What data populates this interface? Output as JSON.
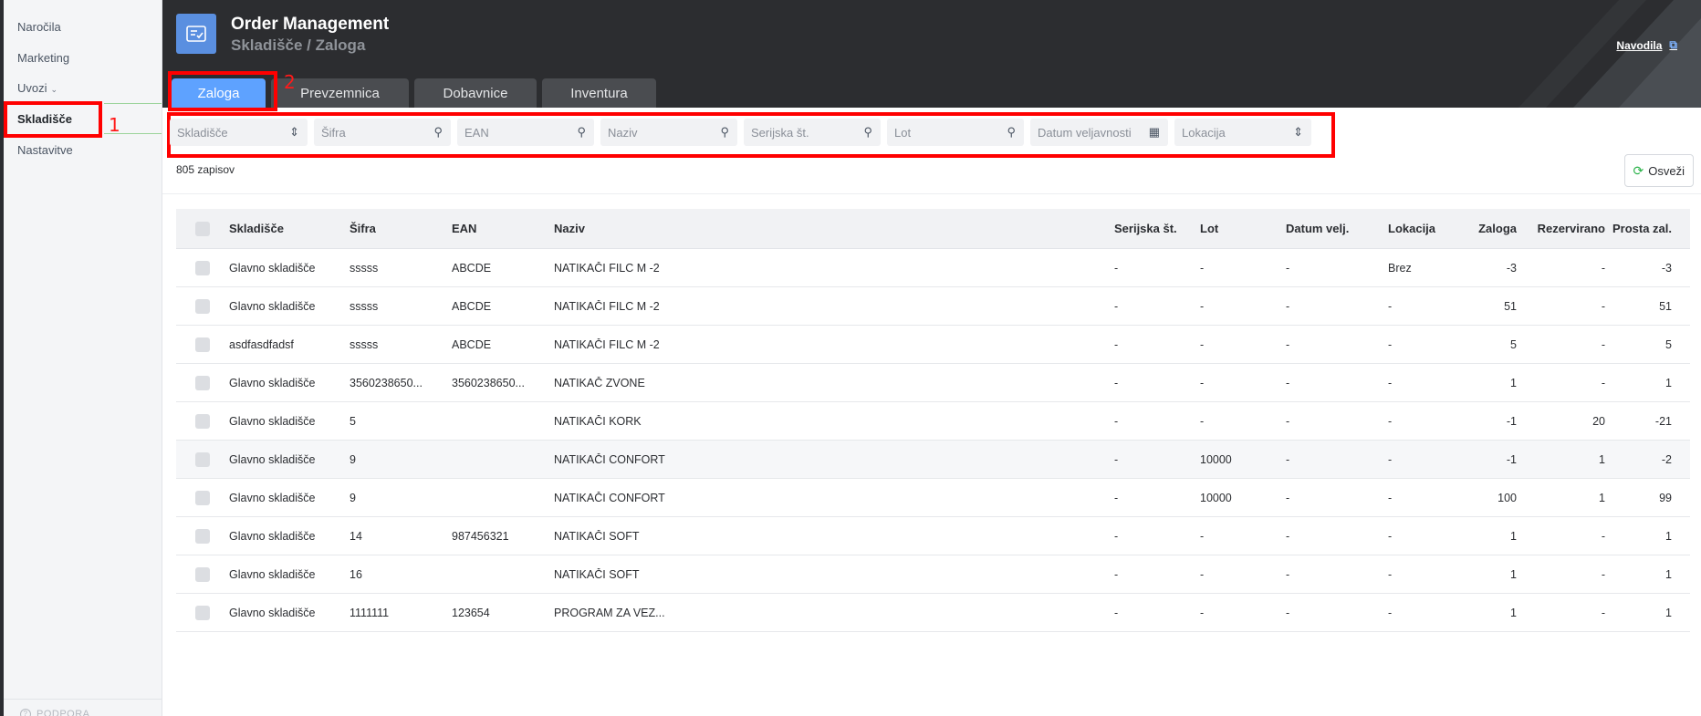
{
  "sidebar": {
    "items": [
      {
        "label": "Naročila"
      },
      {
        "label": "Marketing"
      },
      {
        "label": "Uvozi"
      },
      {
        "label": "Skladišče"
      },
      {
        "label": "Nastavitve"
      }
    ],
    "support_label": "PODPORA"
  },
  "header": {
    "title": "Order Management",
    "subtitle": "Skladišče / Zaloga",
    "help_link": "Navodila"
  },
  "tabs": [
    {
      "label": "Zaloga",
      "active": true
    },
    {
      "label": "Prevzemnica"
    },
    {
      "label": "Dobavnice"
    },
    {
      "label": "Inventura"
    }
  ],
  "annotations": {
    "one": "1",
    "two": "2"
  },
  "filters": {
    "skladisce": "Skladišče",
    "sifra": "Šifra",
    "ean": "EAN",
    "naziv": "Naziv",
    "serijska": "Serijska št.",
    "lot": "Lot",
    "datum": "Datum veljavnosti",
    "lokacija": "Lokacija"
  },
  "records_count": "805 zapisov",
  "refresh_label": "Osveži",
  "table": {
    "columns": {
      "skladisce": "Skladišče",
      "sifra": "Šifra",
      "ean": "EAN",
      "naziv": "Naziv",
      "serijska": "Serijska št.",
      "lot": "Lot",
      "datum": "Datum velj.",
      "lokacija": "Lokacija",
      "zaloga": "Zaloga",
      "rezervirano": "Rezervirano",
      "prosta": "Prosta zal."
    },
    "rows": [
      {
        "skl": "Glavno skladišče",
        "sif": "sssss",
        "ean": "ABCDE",
        "naz": "NATIKAČI FILC M -2",
        "ser": "-",
        "lot": "-",
        "dat": "-",
        "lok": "Brez",
        "zal": "-3",
        "rez": "-",
        "pro": "-3"
      },
      {
        "skl": "Glavno skladišče",
        "sif": "sssss",
        "ean": "ABCDE",
        "naz": "NATIKAČI FILC M -2",
        "ser": "-",
        "lot": "-",
        "dat": "-",
        "lok": "-",
        "zal": "51",
        "rez": "-",
        "pro": "51"
      },
      {
        "skl": "asdfasdfadsf",
        "sif": "sssss",
        "ean": "ABCDE",
        "naz": "NATIKAČI FILC M -2",
        "ser": "-",
        "lot": "-",
        "dat": "-",
        "lok": "-",
        "zal": "5",
        "rez": "-",
        "pro": "5"
      },
      {
        "skl": "Glavno skladišče",
        "sif": "3560238650...",
        "ean": "3560238650...",
        "naz": "NATIKAČ ZVONE",
        "ser": "-",
        "lot": "-",
        "dat": "-",
        "lok": "-",
        "zal": "1",
        "rez": "-",
        "pro": "1"
      },
      {
        "skl": "Glavno skladišče",
        "sif": "5",
        "ean": "",
        "naz": "NATIKAČI KORK",
        "ser": "-",
        "lot": "-",
        "dat": "-",
        "lok": "-",
        "zal": "-1",
        "rez": "20",
        "pro": "-21"
      },
      {
        "skl": "Glavno skladišče",
        "sif": "9",
        "ean": "",
        "naz": "NATIKAČI CONFORT",
        "ser": "-",
        "lot": "10000",
        "dat": "-",
        "lok": "-",
        "zal": "-1",
        "rez": "1",
        "pro": "-2"
      },
      {
        "skl": "Glavno skladišče",
        "sif": "9",
        "ean": "",
        "naz": "NATIKAČI CONFORT",
        "ser": "-",
        "lot": "10000",
        "dat": "-",
        "lok": "-",
        "zal": "100",
        "rez": "1",
        "pro": "99"
      },
      {
        "skl": "Glavno skladišče",
        "sif": "14",
        "ean": "987456321",
        "naz": "NATIKAČI SOFT",
        "ser": "-",
        "lot": "-",
        "dat": "-",
        "lok": "-",
        "zal": "1",
        "rez": "-",
        "pro": "1"
      },
      {
        "skl": "Glavno skladišče",
        "sif": "16",
        "ean": "",
        "naz": "NATIKAČI SOFT",
        "ser": "-",
        "lot": "-",
        "dat": "-",
        "lok": "-",
        "zal": "1",
        "rez": "-",
        "pro": "1"
      },
      {
        "skl": "Glavno skladišče",
        "sif": "1111111",
        "ean": "123654",
        "naz": "PROGRAM ZA VEZ...",
        "ser": "-",
        "lot": "-",
        "dat": "-",
        "lok": "-",
        "zal": "1",
        "rez": "-",
        "pro": "1"
      }
    ]
  },
  "colors": {
    "accent": "#5ea2ff",
    "header_bg": "#2c2d30",
    "annotation": "#ff0000",
    "refresh_icon": "#2bb34a"
  }
}
